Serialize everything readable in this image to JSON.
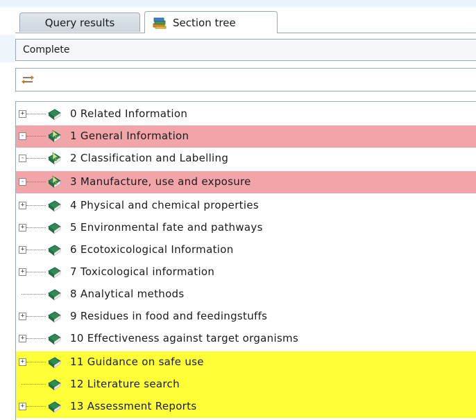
{
  "tabs": [
    {
      "label": "Query results",
      "active": false
    },
    {
      "label": "Section tree",
      "active": true,
      "icon": "book-stack-icon"
    }
  ],
  "toolbar": {
    "status_label": "Complete",
    "filter_icon": "filter-arrows-icon"
  },
  "colors": {
    "highlight_red": "#f2a5a8",
    "highlight_yellow": "#ffff38",
    "book_green": "#2e8b57"
  },
  "tree": {
    "nodes": [
      {
        "num": "0",
        "label": "0 Related Information",
        "expander": "+",
        "highlight": "none"
      },
      {
        "num": "1",
        "label": "1 General Information",
        "expander": "-",
        "highlight": "red"
      },
      {
        "num": "2",
        "label": "2 Classification and Labelling",
        "expander": "-",
        "highlight": "none"
      },
      {
        "num": "3",
        "label": "3 Manufacture, use and exposure",
        "expander": "-",
        "highlight": "red"
      },
      {
        "num": "4",
        "label": "4 Physical and chemical properties",
        "expander": "+",
        "highlight": "none"
      },
      {
        "num": "5",
        "label": "5 Environmental fate and pathways",
        "expander": "+",
        "highlight": "none"
      },
      {
        "num": "6",
        "label": "6 Ecotoxicological Information",
        "expander": "+",
        "highlight": "none"
      },
      {
        "num": "7",
        "label": "7 Toxicological information",
        "expander": "+",
        "highlight": "none"
      },
      {
        "num": "8",
        "label": "8 Analytical methods",
        "expander": "",
        "highlight": "none"
      },
      {
        "num": "9",
        "label": "9 Residues in food and feedingstuffs",
        "expander": "+",
        "highlight": "none"
      },
      {
        "num": "10",
        "label": "10 Effectiveness against target organisms",
        "expander": "+",
        "highlight": "none"
      },
      {
        "num": "11",
        "label": "11 Guidance on safe use",
        "expander": "+",
        "highlight": "yellow"
      },
      {
        "num": "12",
        "label": "12 Literature search",
        "expander": "",
        "highlight": "yellow"
      },
      {
        "num": "13",
        "label": "13 Assessment Reports",
        "expander": "+",
        "highlight": "yellow"
      }
    ]
  }
}
